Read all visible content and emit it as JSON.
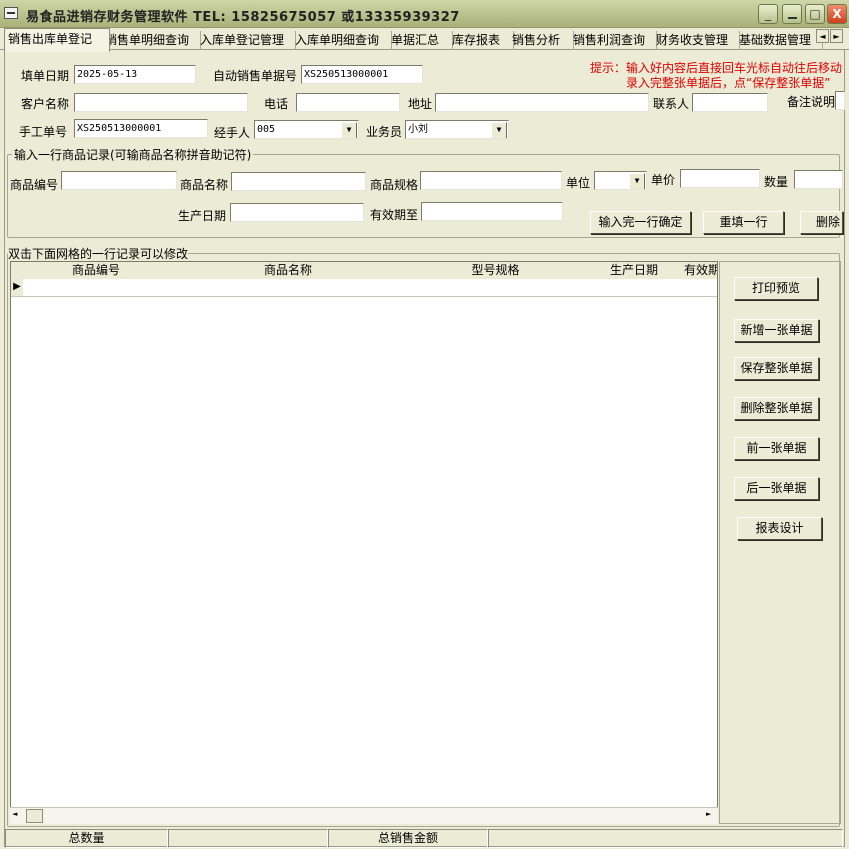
{
  "window": {
    "title": "易食品进销存财务管理软件   TEL: 15825675057 或13335939327",
    "buttons": [
      "_",
      "□",
      "X"
    ]
  },
  "tabs": [
    {
      "label": "销售出库单登记",
      "active": true
    },
    {
      "label": "销售单明细查询"
    },
    {
      "label": "入库单登记管理"
    },
    {
      "label": "入库单明细查询"
    },
    {
      "label": "单据汇总"
    },
    {
      "label": "库存报表"
    },
    {
      "label": "销售分析"
    },
    {
      "label": "销售利润查询"
    },
    {
      "label": "财务收支管理"
    },
    {
      "label": "基础数据管理"
    }
  ],
  "tab_scroll": {
    "left": "◄",
    "right": "►"
  },
  "header_form": {
    "fill_date_label": "填单日期",
    "fill_date": "2025-05-13",
    "auto_no_label": "自动销售单据号",
    "auto_no": "XS250513000001",
    "customer_label": "客户名称",
    "customer": "",
    "phone_label": "电话",
    "phone": "",
    "address_label": "地址",
    "address": "",
    "contact_label": "联系人",
    "contact": "",
    "remark_label": "备注说明",
    "manual_no_label": "手工单号",
    "manual_no": "XS250513000001",
    "handler_label": "经手人",
    "handler": "005",
    "salesman_label": "业务员",
    "salesman": "小刘"
  },
  "hint": {
    "line1": "提示：输入好内容后直接回车光标自动往后移动",
    "line2": "录入完整张单据后，点“保存整张单据”"
  },
  "item_entry": {
    "legend": "输入一行商品记录(可输商品名称拼音助记符)",
    "code_label": "商品编号",
    "name_label": "商品名称",
    "spec_label": "商品规格",
    "unit_label": "单位",
    "price_label": "单价",
    "qty_label": "数量",
    "prod_date_label": "生产日期",
    "expiry_label": "有效期至",
    "confirm_button": "输入完一行确定",
    "reset_button": "重填一行",
    "delete_button": "删除"
  },
  "grid": {
    "legend": "双击下面网格的一行记录可以修改",
    "columns": [
      "商品编号",
      "商品名称",
      "型号规格",
      "生产日期",
      "有效期至"
    ],
    "row_indicator": "▶"
  },
  "side_buttons": {
    "print_preview": "打印预览",
    "new_doc": "新增一张单据",
    "save_doc": "保存整张单据",
    "delete_doc": "删除整张单据",
    "prev_doc": "前一张单据",
    "next_doc": "后一张单据",
    "report_design": "报表设计"
  },
  "status_bar": {
    "total_qty_label": "总数量",
    "total_qty": "",
    "total_amount_label": "总销售金额",
    "total_amount": ""
  },
  "scroll": {
    "left": "◄",
    "right": "►"
  }
}
